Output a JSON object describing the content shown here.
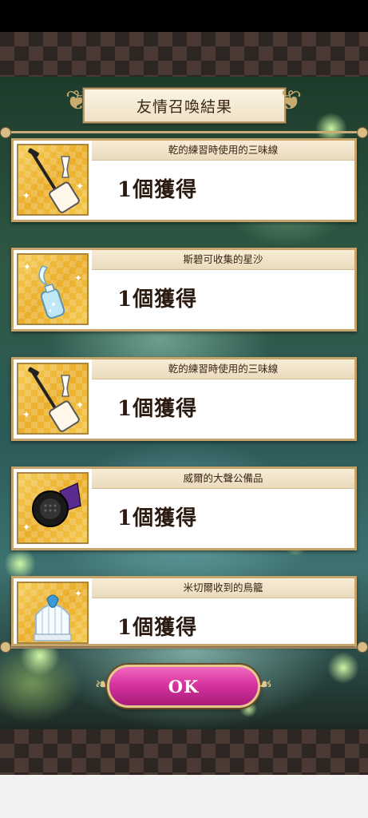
{
  "header": {
    "title": "友情召喚結果"
  },
  "results": [
    {
      "item_name": "乾的練習時使用的三味線",
      "count_text": "1個獲得",
      "icon": "shamisen-icon"
    },
    {
      "item_name": "斯碧可收集的星沙",
      "count_text": "1個獲得",
      "icon": "star-sand-bottle-icon"
    },
    {
      "item_name": "乾的練習時使用的三味線",
      "count_text": "1個獲得",
      "icon": "shamisen-icon"
    },
    {
      "item_name": "威爾的大聲公備品",
      "count_text": "1個獲得",
      "icon": "megaphone-icon"
    },
    {
      "item_name": "米切爾收到的鳥籠",
      "count_text": "1個獲得",
      "icon": "birdcage-icon"
    }
  ],
  "footer": {
    "ok_label": "OK"
  },
  "colors": {
    "card_border": "#c6a46c",
    "icon_bg": "#eaae2a",
    "ok_button": "#d8349f"
  }
}
